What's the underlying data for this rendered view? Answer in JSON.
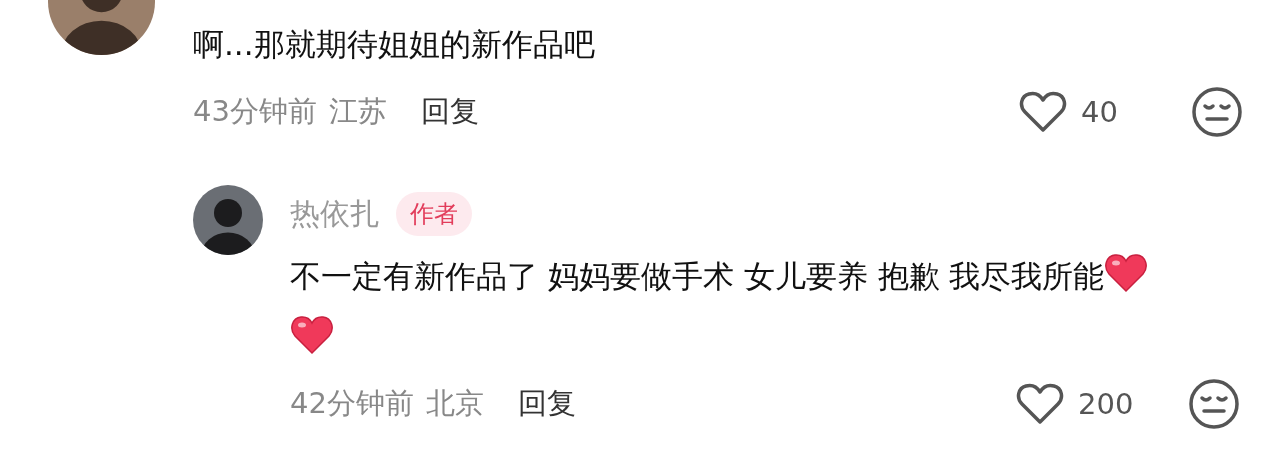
{
  "comment": {
    "text": "啊...那就期待姐姐的新作品吧",
    "time": "43分钟前",
    "location": "江苏",
    "reply": "回复",
    "likes": "40"
  },
  "reply": {
    "author": "热依扎",
    "badge": "作者",
    "text": "不一定有新作品了 妈妈要做手术 女儿要养 抱歉 我尽我所能",
    "time": "42分钟前",
    "location": "北京",
    "reply": "回复",
    "likes": "200"
  }
}
